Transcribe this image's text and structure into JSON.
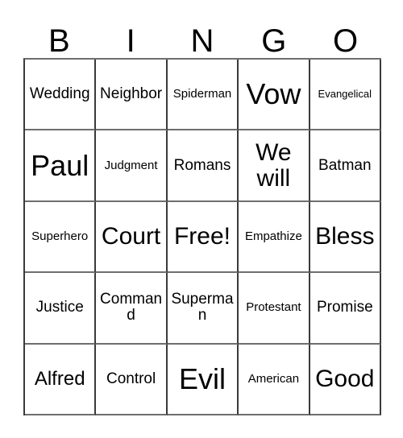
{
  "card": {
    "title": "BINGO",
    "header_letters": [
      "B",
      "I",
      "N",
      "G",
      "O"
    ],
    "grid_size": "5x5",
    "border_color": "#3a3a3a",
    "background_color": "#ffffff",
    "text_color": "#000000",
    "free_space": "Free!",
    "rows": [
      [
        {
          "label": "Wedding",
          "size": "m"
        },
        {
          "label": "Neighbor",
          "size": "m"
        },
        {
          "label": "Spiderman",
          "size": "s"
        },
        {
          "label": "Vow",
          "size": "xxl"
        },
        {
          "label": "Evangelical",
          "size": "xs"
        }
      ],
      [
        {
          "label": "Paul",
          "size": "xxl"
        },
        {
          "label": "Judgment",
          "size": "s"
        },
        {
          "label": "Romans",
          "size": "m"
        },
        {
          "label": "We will",
          "size": "xl"
        },
        {
          "label": "Batman",
          "size": "m"
        }
      ],
      [
        {
          "label": "Superhero",
          "size": "s"
        },
        {
          "label": "Court",
          "size": "xl"
        },
        {
          "label": "Free!",
          "size": "xl"
        },
        {
          "label": "Empathize",
          "size": "s"
        },
        {
          "label": "Bless",
          "size": "xl"
        }
      ],
      [
        {
          "label": "Justice",
          "size": "m"
        },
        {
          "label": "Command",
          "size": "m"
        },
        {
          "label": "Superman",
          "size": "m"
        },
        {
          "label": "Protestant",
          "size": "s"
        },
        {
          "label": "Promise",
          "size": "m"
        }
      ],
      [
        {
          "label": "Alfred",
          "size": "l"
        },
        {
          "label": "Control",
          "size": "m"
        },
        {
          "label": "Evil",
          "size": "xxl"
        },
        {
          "label": "American",
          "size": "s"
        },
        {
          "label": "Good",
          "size": "xl"
        }
      ]
    ]
  }
}
